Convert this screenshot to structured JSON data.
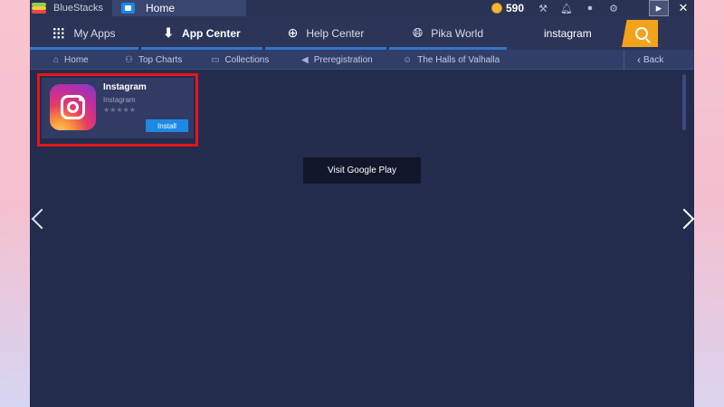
{
  "titlebar": {
    "app_name": "BlueStacks",
    "home_tab": "Home",
    "coins": "590",
    "icons": [
      "wrench-icon",
      "bell-icon",
      "account-icon",
      "gear-icon",
      "expand-icon",
      "close-icon"
    ]
  },
  "nav": {
    "tabs": [
      {
        "label": "My Apps",
        "icon": "grid-icon"
      },
      {
        "label": "App Center",
        "icon": "download-icon",
        "active": true
      },
      {
        "label": "Help Center",
        "icon": "lifebuoy-icon"
      },
      {
        "label": "Pika World",
        "icon": "globe-icon"
      }
    ],
    "search_value": "instagram"
  },
  "subnav": {
    "items": [
      {
        "label": "Home",
        "icon": "home-icon"
      },
      {
        "label": "Top Charts",
        "icon": "user-icon"
      },
      {
        "label": "Collections",
        "icon": "collections-icon"
      },
      {
        "label": "Preregistration",
        "icon": "megaphone-icon"
      },
      {
        "label": "The Halls of Valhalla",
        "icon": "gamepad-icon"
      }
    ],
    "back_label": "Back"
  },
  "result": {
    "title": "Instagram",
    "developer": "Instagram",
    "rating": "★★★★★",
    "install_label": "Install"
  },
  "google_play_label": "Visit Google Play",
  "colors": {
    "accent": "#1e88e5",
    "search_button": "#f2a31b",
    "highlight": "#e4161b",
    "content_bg": "#232c4d"
  }
}
